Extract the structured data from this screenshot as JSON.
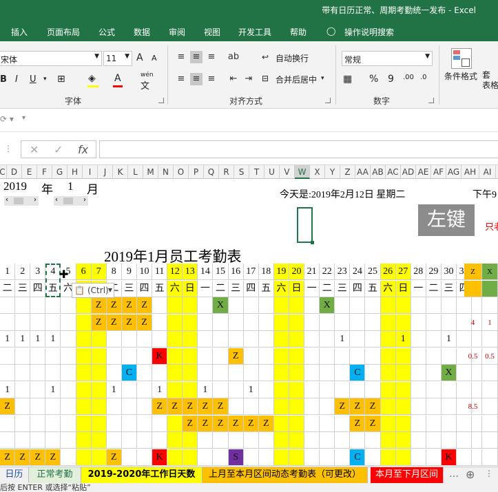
{
  "window": {
    "title": "带有日历正常、周期考勤统一发布 - Excel"
  },
  "tabs": [
    "插入",
    "页面布局",
    "公式",
    "数据",
    "审阅",
    "视图",
    "开发工具",
    "帮助",
    "操作说明搜索"
  ],
  "ribbon": {
    "font_name": "宋体",
    "font_size": "11",
    "bold": "B",
    "italic": "I",
    "underline": "U",
    "wen": "wén",
    "font_group": "字体",
    "wrap_text": "自动换行",
    "merge_center": "合并后居中",
    "align_group": "对齐方式",
    "number_format": "常规",
    "percent": "%",
    "comma": "9",
    "number_group": "数字",
    "cond_format": "条件格式",
    "table_fmt": "套\n表格",
    "grow_font": "A",
    "shrink_font": "A"
  },
  "formula_bar": {
    "fx": "fx",
    "cancel": "✕",
    "enter": "✓"
  },
  "columns": [
    "C",
    "D",
    "E",
    "F",
    "G",
    "H",
    "I",
    "J",
    "K",
    "L",
    "M",
    "N",
    "O",
    "P",
    "Q",
    "R",
    "S",
    "T",
    "U",
    "V",
    "W",
    "X",
    "Y",
    "Z",
    "AA",
    "AB",
    "AC",
    "AD",
    "AE",
    "AF",
    "AG",
    "AH",
    "AI"
  ],
  "sheet": {
    "year": "2019",
    "year_unit": "年",
    "month": "1",
    "month_unit": "月",
    "today": "今天是:2019年2月12日 星期二",
    "time_prefix": "下午9",
    "left_key": "左键",
    "only_text": "只老",
    "table_title": "2019年1月员工考勤表",
    "paste_tag": "(Ctrl)",
    "days": [
      "1",
      "2",
      "3",
      "4",
      "5",
      "6",
      "7",
      "8",
      "9",
      "10",
      "11",
      "12",
      "13",
      "14",
      "15",
      "16",
      "17",
      "18",
      "19",
      "20",
      "21",
      "22",
      "23",
      "24",
      "25",
      "26",
      "27",
      "28",
      "29",
      "30",
      "31"
    ],
    "weekdays": [
      "二",
      "三",
      "四",
      "五",
      "六",
      "日",
      "一",
      "二",
      "三",
      "四",
      "五",
      "六",
      "日",
      "一",
      "二",
      "三",
      "四",
      "五",
      "六",
      "日",
      "一",
      "二",
      "三",
      "四",
      "五",
      "六",
      "日",
      "一",
      "二",
      "三",
      "四"
    ],
    "summary_headers": [
      "Z",
      "X"
    ],
    "summary_values": [
      [
        "4",
        "1"
      ],
      [
        "0.5",
        "0.5"
      ],
      [
        "8.5",
        ""
      ]
    ]
  },
  "sheet_tabs": [
    "日历",
    "正常考勤",
    "2019-2020年工作日天数",
    "上月至本月区间动态考勤表（可更改）",
    "本月至下月区间"
  ],
  "status_text": "后按 ENTER 或选择“粘贴”",
  "colors": {
    "excel_green": "#217346",
    "weekend": "#ffff00",
    "leave": "#ffc000"
  }
}
